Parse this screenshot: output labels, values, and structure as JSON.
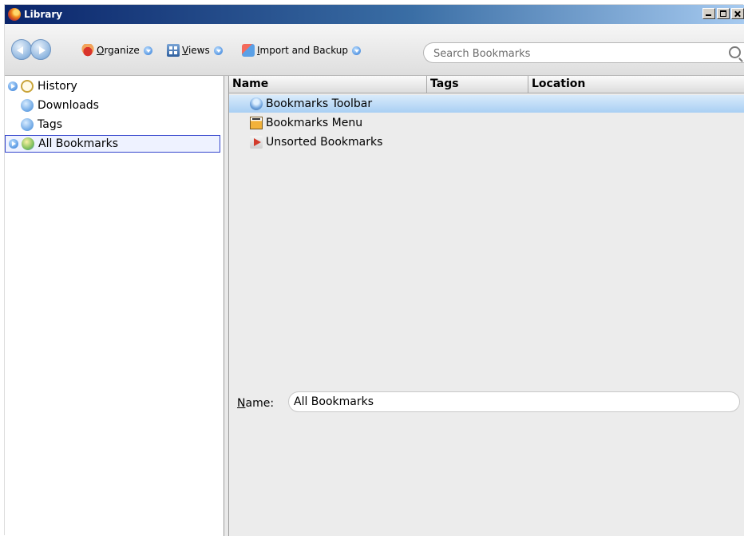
{
  "window": {
    "title": "Library"
  },
  "toolbar": {
    "organize": {
      "accesskey": "O",
      "rest": "rganize",
      "icon": "organize-icon"
    },
    "views": {
      "accesskey": "V",
      "rest": "iews",
      "icon": "views-icon"
    },
    "import_backup": {
      "accesskey": "I",
      "rest": "mport and Backup",
      "icon": "import-backup-icon"
    }
  },
  "search": {
    "placeholder": "Search Bookmarks",
    "value": ""
  },
  "sidebar": {
    "items": [
      {
        "label": "History",
        "icon": "history-icon",
        "expandable": true
      },
      {
        "label": "Downloads",
        "icon": "downloads-icon",
        "expandable": false
      },
      {
        "label": "Tags",
        "icon": "tags-icon",
        "expandable": false
      },
      {
        "label": "All Bookmarks",
        "icon": "all-bookmarks-icon",
        "expandable": true,
        "selected": true
      }
    ]
  },
  "table": {
    "columns": [
      "Name",
      "Tags",
      "Location"
    ],
    "rows": [
      {
        "name": "Bookmarks Toolbar",
        "icon": "bookmarks-toolbar-icon",
        "selected": true
      },
      {
        "name": "Bookmarks Menu",
        "icon": "bookmarks-menu-icon"
      },
      {
        "name": "Unsorted Bookmarks",
        "icon": "unsorted-bookmarks-icon"
      }
    ]
  },
  "details": {
    "name_label_accesskey": "N",
    "name_label_rest": "ame:",
    "name_value": "All Bookmarks"
  },
  "colors": {
    "title_bar_start": "#0a246a",
    "selection": "#a9cff3",
    "sidebar_selection_border": "#3344cc"
  }
}
